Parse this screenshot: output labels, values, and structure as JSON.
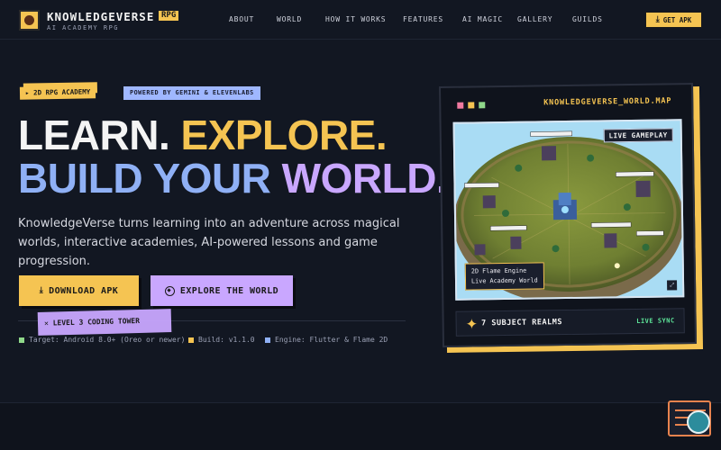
{
  "nav": {
    "brand": "KNOWLEDGEVERSE",
    "brand_tag": "RPG",
    "brand_sub": "AI ACADEMY RPG",
    "links": [
      "ABOUT",
      "WORLD",
      "HOW IT WORKS",
      "FEATURES",
      "AI MAGIC",
      "GALLERY",
      "GUILDS"
    ],
    "cta": "GET APK"
  },
  "hero": {
    "badge_rpg": "2D RPG ACADEMY",
    "badge_powered": "POWERED BY GEMINI & ELEVENLABS",
    "line1_a": "LEARN.",
    "line1_b": "EXPLORE.",
    "line2_a": "BUILD YOUR",
    "line2_b": "WORLD.",
    "description": "KnowledgeVerse turns learning into an adventure across magical worlds, interactive academies, AI-powered lessons and game progression.",
    "download_button": "DOWNLOAD APK",
    "explore_button": "EXPLORE THE WORLD",
    "sticker": "LEVEL 3 CODING TOWER",
    "meta": [
      {
        "text": "Target: Android 8.0+ (Oreo or newer)",
        "color": "#8fd88a"
      },
      {
        "text": "Build: v1.1.0",
        "color": "#f5c452"
      },
      {
        "text": "Engine: Flutter & Flame 2D",
        "color": "#8fb0f5"
      }
    ]
  },
  "map_panel": {
    "title": "KNOWLEDGEVERSE_WORLD.MAP",
    "live_badge": "LIVE GAMEPLAY",
    "engine_line1": "2D Flame Engine",
    "engine_line2": "Live Academy World",
    "realms": "7 SUBJECT REALMS",
    "live_sync": "LIVE SYNC",
    "dot_colors": [
      "#f07aa0",
      "#f5c452",
      "#8fd88a"
    ]
  },
  "colors": {
    "background": "#121722",
    "accent_yellow": "#f5c452",
    "accent_blue": "#8fb0f5",
    "accent_purple": "#c9a7ff"
  }
}
